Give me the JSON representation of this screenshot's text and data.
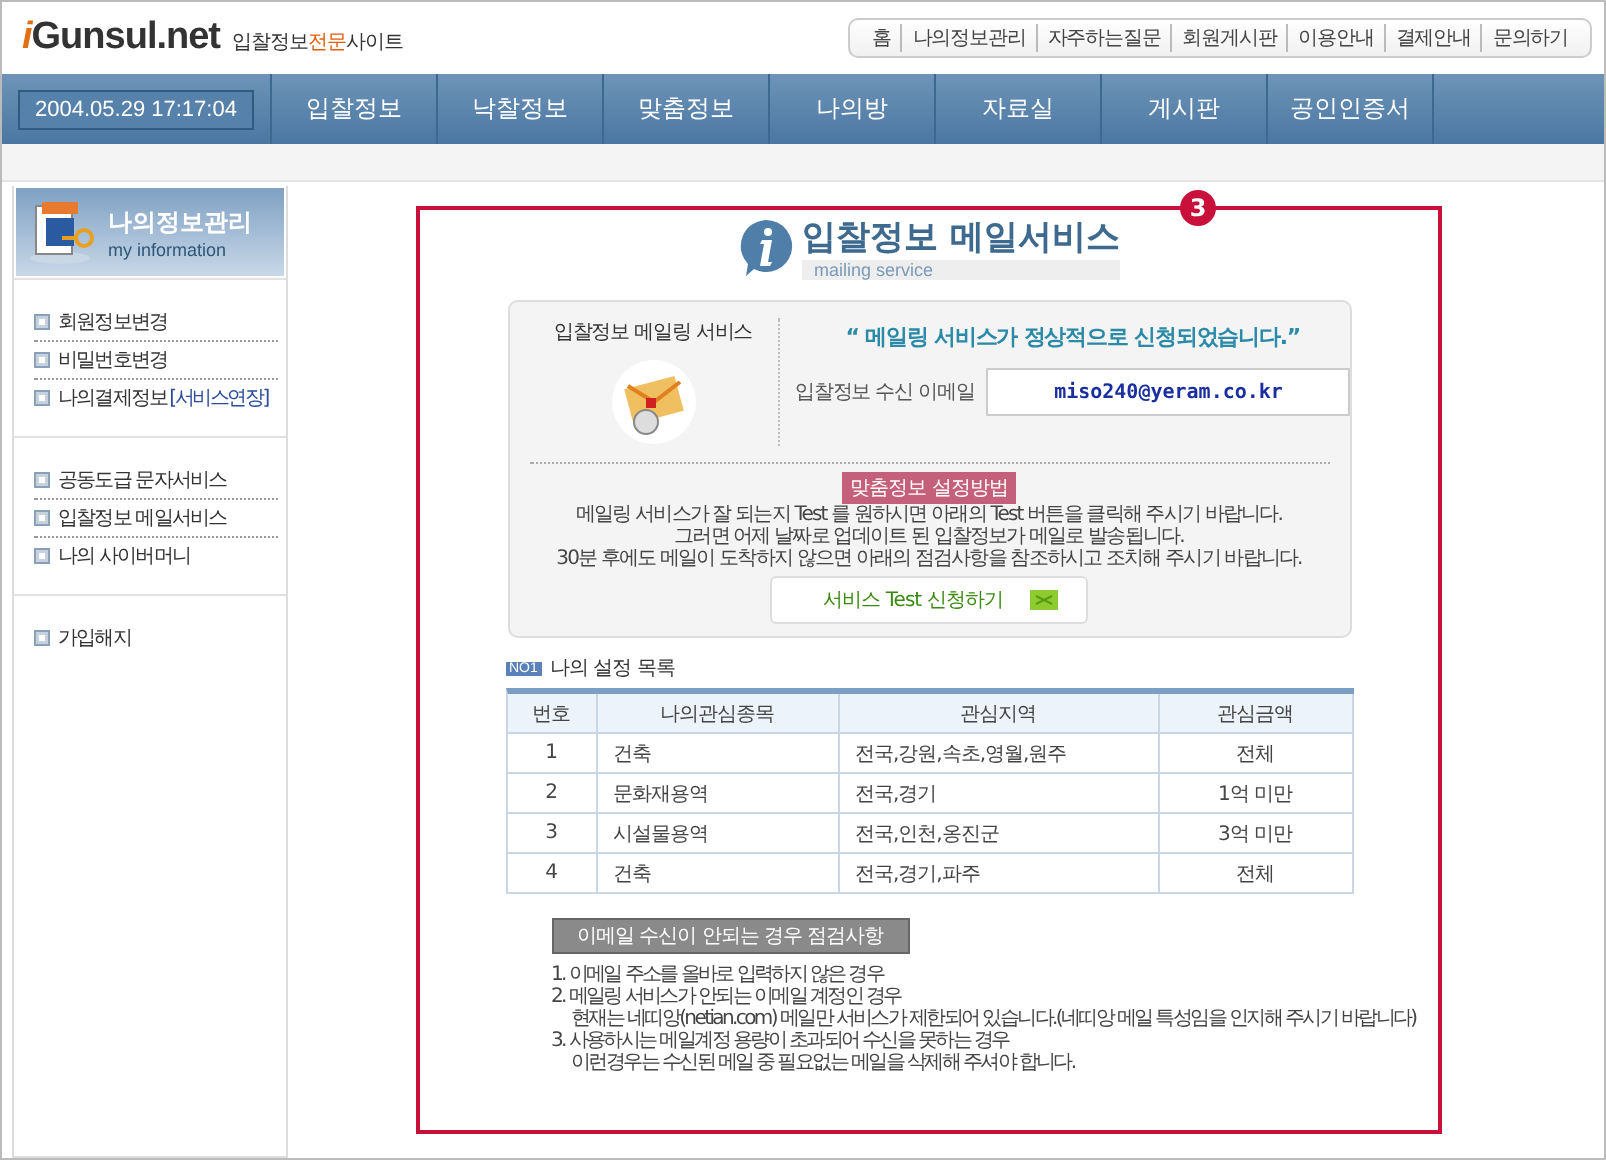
{
  "logo": {
    "mark": "i",
    "brand": "Gunsul.net",
    "tagline_parts": [
      {
        "text": "입찰정보",
        "accent": false
      },
      {
        "text": "전문",
        "accent": true
      },
      {
        "text": "사이트",
        "accent": false
      }
    ]
  },
  "top_links": [
    "홈",
    "나의정보관리",
    "자주하는질문",
    "회원게시판",
    "이용안내",
    "결제안내",
    "문의하기"
  ],
  "clock": "2004.05.29 17:17:04",
  "nav": [
    "입찰정보",
    "낙찰정보",
    "맞춤정보",
    "나의방",
    "자료실",
    "게시판",
    "공인인증서"
  ],
  "sidebar": {
    "title": "나의정보관리",
    "subtitle": "my information",
    "groups": [
      [
        {
          "label": "회원정보변경"
        },
        {
          "label": "비밀번호변경"
        },
        {
          "label": "나의결제정보",
          "extra": "[서비스연장]"
        }
      ],
      [
        {
          "label": "공동도급 문자서비스"
        },
        {
          "label": "입찰정보 메일서비스"
        },
        {
          "label": "나의 사이버머니"
        }
      ],
      [
        {
          "label": "가입해지"
        }
      ]
    ]
  },
  "marker": "3",
  "page_title": {
    "title": "입찰정보 메일서비스",
    "subtitle": "mailing service"
  },
  "service": {
    "label": "입찰정보 메일링 서비스",
    "message": "“ 메일링 서비스가 정상적으로 신청되었습니다.”",
    "email_label": "입찰정보 수신 이메일",
    "email": "miso240@yeram.co.kr",
    "howto_title": "맞춤정보 설정방법",
    "howto_lines": [
      "메일링 서비스가 잘 되는지  Test 를 원하시면 아래의 Test 버튼을 클릭해 주시기 바랍니다.",
      "그러면 어제 날짜로 업데이트 된 입찰정보가 메일로 발송됩니다.",
      "30분 후에도 메일이 도착하지 않으면 아래의 점검사항을 참조하시고 조치해 주시기 바랍니다."
    ],
    "test_button": "서비스 Test 신청하기"
  },
  "settings": {
    "badge": "NO1",
    "title": "나의 설정 목록",
    "columns": [
      "번호",
      "나의관심종목",
      "관심지역",
      "관심금액"
    ],
    "rows": [
      [
        "1",
        "건축",
        "전국,강원,속초,영월,원주",
        "전체"
      ],
      [
        "2",
        "문화재용역",
        "전국,경기",
        "1억 미만"
      ],
      [
        "3",
        "시설물용역",
        "전국,인천,옹진군",
        "3억 미만"
      ],
      [
        "4",
        "건축",
        "전국,경기,파주",
        "전체"
      ]
    ]
  },
  "checklist": {
    "title": "이메일 수신이 안되는 경우 점검사항",
    "items": [
      {
        "text": "1. 이메일 주소를 올바로 입력하지 않은 경우"
      },
      {
        "text": "2. 메일링 서비스가 안되는 이메일 계정인 경우",
        "notes": [
          "현재는 네띠앙(netian.com) 메일만 서비스가 제한되어 있습니다.(네띠앙 메일 특성임을 인지해 주시기 바랍니다)"
        ]
      },
      {
        "text": "3. 사용하시는 메일계정 용량이 초과되어 수신을 못하는 경우",
        "notes": [
          "이런경우는 수신된 메일 중 필요없는 메일을 삭제해 주셔야 합니다."
        ]
      }
    ]
  }
}
